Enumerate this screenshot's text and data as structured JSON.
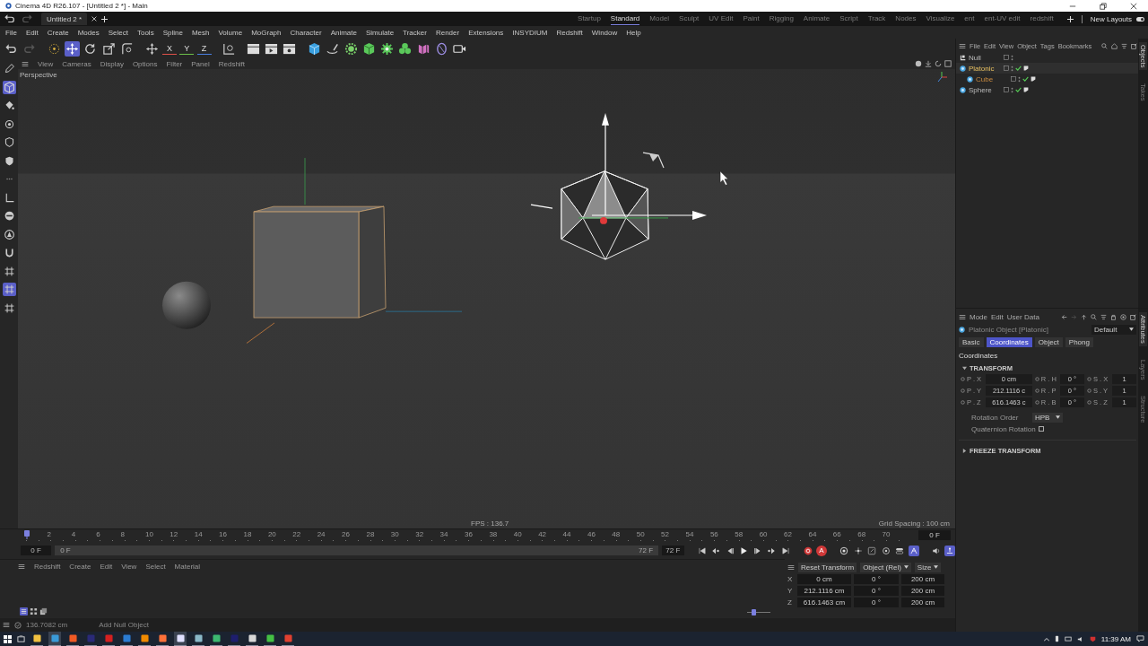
{
  "window": {
    "title": "Cinema 4D R26.107 - [Untitled 2 *] - Main"
  },
  "document_tabs": [
    {
      "label": "Untitled 2 *",
      "selected": true
    }
  ],
  "layouts": [
    {
      "label": "Startup",
      "selected": false
    },
    {
      "label": "Standard",
      "selected": true
    },
    {
      "label": "Model",
      "selected": false
    },
    {
      "label": "Sculpt",
      "selected": false
    },
    {
      "label": "UV Edit",
      "selected": false
    },
    {
      "label": "Paint",
      "selected": false
    },
    {
      "label": "Rigging",
      "selected": false
    },
    {
      "label": "Animate",
      "selected": false
    },
    {
      "label": "Script",
      "selected": false
    },
    {
      "label": "Track",
      "selected": false
    },
    {
      "label": "Nodes",
      "selected": false
    },
    {
      "label": "Visualize",
      "selected": false
    },
    {
      "label": "ent",
      "selected": false
    },
    {
      "label": "ent-UV edit",
      "selected": false
    },
    {
      "label": "redshift",
      "selected": false
    }
  ],
  "new_layouts": {
    "label": "New Layouts",
    "on": true
  },
  "menu": [
    "File",
    "Edit",
    "Create",
    "Modes",
    "Select",
    "Tools",
    "Spline",
    "Mesh",
    "Volume",
    "MoGraph",
    "Character",
    "Animate",
    "Simulate",
    "Tracker",
    "Render",
    "Extensions",
    "INSYDIUM",
    "Redshift",
    "Window",
    "Help"
  ],
  "toolbar": [
    {
      "kind": "undo",
      "selected": false
    },
    {
      "kind": "redo",
      "selected": false
    },
    {
      "kind": "select",
      "selected": false
    },
    {
      "kind": "move",
      "selected": true
    },
    {
      "kind": "rotate",
      "selected": false
    },
    {
      "kind": "scale",
      "selected": false
    },
    {
      "kind": "transform",
      "selected": false
    },
    {
      "kind": "cross",
      "selected": false
    },
    {
      "kind": "axis",
      "label": "X",
      "color": "#e0504a",
      "selected": false
    },
    {
      "kind": "axis",
      "label": "Y",
      "color": "#6cc04a",
      "selected": false
    },
    {
      "kind": "axis",
      "label": "Z",
      "color": "#4a7ee0",
      "selected": false
    },
    {
      "kind": "world",
      "selected": false
    },
    {
      "kind": "clapper",
      "selected": false
    },
    {
      "kind": "clapperplay",
      "selected": false
    },
    {
      "kind": "clappergear",
      "selected": false
    },
    {
      "kind": "cube",
      "selected": false
    },
    {
      "kind": "pen",
      "selected": false
    },
    {
      "kind": "subdiv",
      "selected": false
    },
    {
      "kind": "extrude",
      "selected": false
    },
    {
      "kind": "cloner",
      "selected": false
    },
    {
      "kind": "mograph",
      "selected": false
    },
    {
      "kind": "deformer",
      "selected": false
    },
    {
      "kind": "field",
      "selected": false
    },
    {
      "kind": "camera",
      "selected": false
    }
  ],
  "left_tools": [
    {
      "kind": "pencil",
      "selected": false
    },
    {
      "kind": "model",
      "selected": true
    },
    {
      "kind": "paint",
      "selected": false
    },
    {
      "kind": "point",
      "selected": false
    },
    {
      "kind": "edge",
      "selected": false
    },
    {
      "kind": "polygon",
      "selected": false
    },
    {
      "kind": "dots",
      "selected": false
    },
    {
      "kind": "angle",
      "selected": false
    },
    {
      "kind": "disc",
      "selected": false
    },
    {
      "kind": "face",
      "selected": false
    },
    {
      "kind": "magnet",
      "selected": false
    },
    {
      "kind": "grid",
      "selected": false
    },
    {
      "kind": "grid",
      "selected": true
    },
    {
      "kind": "grid",
      "selected": false
    }
  ],
  "viewport": {
    "menu": [
      "View",
      "Cameras",
      "Display",
      "Options",
      "Filter",
      "Panel",
      "Redshift"
    ],
    "camera": "Perspective",
    "fps": "FPS : 136.7",
    "grid_spacing": "Grid Spacing : 100 cm"
  },
  "objects": {
    "menu": [
      "File",
      "Edit",
      "View",
      "Object",
      "Tags",
      "Bookmarks"
    ],
    "side_tabs": [
      {
        "label": "Objects",
        "selected": true
      },
      {
        "label": "Takes",
        "selected": false
      }
    ],
    "tree": [
      {
        "name": "Null",
        "kind": "null",
        "selected": false,
        "highlighted": false
      },
      {
        "name": "Platonic",
        "kind": "generator",
        "selected": true,
        "highlighted": false,
        "children": [
          {
            "name": "Cube",
            "kind": "generator",
            "selected": false,
            "highlighted": true
          }
        ]
      },
      {
        "name": "Sphere",
        "kind": "generator",
        "selected": false,
        "highlighted": false
      }
    ]
  },
  "attributes": {
    "menu": [
      "Mode",
      "Edit",
      "User Data"
    ],
    "side_tabs": [
      {
        "label": "Attributes",
        "selected": true
      },
      {
        "label": "Layers",
        "selected": false
      },
      {
        "label": "Structure",
        "selected": false
      }
    ],
    "object_label": "Platonic Object [Platonic]",
    "preset": "Default",
    "tabs": [
      {
        "label": "Basic",
        "selected": false
      },
      {
        "label": "Coordinates",
        "selected": true
      },
      {
        "label": "Object",
        "selected": false
      },
      {
        "label": "Phong",
        "selected": false
      }
    ],
    "section": "Coordinates",
    "groups": [
      {
        "title": "TRANSFORM",
        "expanded": true,
        "params": [
          {
            "label": "P . X",
            "value": "0 cm"
          },
          {
            "label": "R . H",
            "value": "0 °"
          },
          {
            "label": "S . X",
            "value": "1"
          },
          {
            "label": "P . Y",
            "value": "212.1116 c"
          },
          {
            "label": "R . P",
            "value": "0 °"
          },
          {
            "label": "S . Y",
            "value": "1"
          },
          {
            "label": "P . Z",
            "value": "616.1463 c"
          },
          {
            "label": "R . B",
            "value": "0 °"
          },
          {
            "label": "S . Z",
            "value": "1"
          }
        ],
        "rotation_order": {
          "label": "Rotation Order",
          "value": "HPB"
        },
        "quaternion": {
          "label": "Quaternion Rotation",
          "checked": false
        }
      },
      {
        "title": "FREEZE TRANSFORM",
        "expanded": false
      }
    ]
  },
  "timeline": {
    "ticks": [
      "2",
      "4",
      "6",
      "8",
      "10",
      "12",
      "14",
      "16",
      "18",
      "20",
      "22",
      "24",
      "26",
      "28",
      "30",
      "32",
      "34",
      "36",
      "38",
      "40",
      "42",
      "44",
      "46",
      "48",
      "50",
      "52",
      "54",
      "56",
      "58",
      "60",
      "62",
      "64",
      "66",
      "68",
      "70"
    ],
    "current": "0 F",
    "start": "0 F",
    "range_start": "0 F",
    "range_end": "72 F",
    "end": "72 F",
    "buttons": [
      {
        "kind": "first",
        "selected": false
      },
      {
        "kind": "prevkey",
        "selected": false
      },
      {
        "kind": "prev",
        "selected": false
      },
      {
        "kind": "play",
        "selected": false
      },
      {
        "kind": "next",
        "selected": false
      },
      {
        "kind": "nextkey",
        "selected": false
      },
      {
        "kind": "last",
        "selected": false
      },
      {
        "kind": "record",
        "selected": false
      },
      {
        "kind": "autokey",
        "label": "A",
        "selected": false
      },
      {
        "kind": "keyframe",
        "selected": false
      },
      {
        "kind": "keymove",
        "selected": false
      },
      {
        "kind": "keyscale",
        "selected": false
      },
      {
        "kind": "keyrotate",
        "selected": false
      },
      {
        "kind": "keyparam",
        "selected": false
      },
      {
        "kind": "keypoint",
        "selected": true
      },
      {
        "kind": "sound",
        "selected": false
      },
      {
        "kind": "timeline",
        "selected": true
      }
    ]
  },
  "material_manager": {
    "menu": [
      "Redshift",
      "Create",
      "Edit",
      "View",
      "Select",
      "Material"
    ],
    "zoom": {
      "level": 0.25
    }
  },
  "coordinates": {
    "reset": "Reset Transform",
    "mode": "Object (Rel)",
    "size_mode": "Size",
    "rows": [
      {
        "axis": "X",
        "position": "0 cm",
        "rotation": "0 °",
        "size": "200 cm"
      },
      {
        "axis": "Y",
        "position": "212.1116 cm",
        "rotation": "0 °",
        "size": "200 cm"
      },
      {
        "axis": "Z",
        "position": "616.1463 cm",
        "rotation": "0 °",
        "size": "200 cm"
      }
    ]
  },
  "status_bar": {
    "value": "136.7082 cm",
    "message": "Add Null Object"
  },
  "taskbar": {
    "apps": [
      {
        "color": "#f0c040",
        "selected": false
      },
      {
        "color": "#3a9ad8",
        "selected": true
      },
      {
        "color": "#f05a24",
        "selected": false
      },
      {
        "color": "#2a2a78",
        "selected": false
      },
      {
        "color": "#d42020",
        "selected": false
      },
      {
        "color": "#2b7cd3",
        "selected": false
      },
      {
        "color": "#f08a00",
        "selected": false
      },
      {
        "color": "#ff7139",
        "selected": false
      },
      {
        "color": "#e0e0ff",
        "selected": true
      },
      {
        "color": "#8ab8c8",
        "selected": false
      },
      {
        "color": "#3cb870",
        "selected": false
      },
      {
        "color": "#1e1e6e",
        "selected": false
      },
      {
        "color": "#d8d8d8",
        "selected": false
      },
      {
        "color": "#44c044",
        "selected": false
      },
      {
        "color": "#e04030",
        "selected": false
      }
    ],
    "time": "11:39 AM"
  }
}
